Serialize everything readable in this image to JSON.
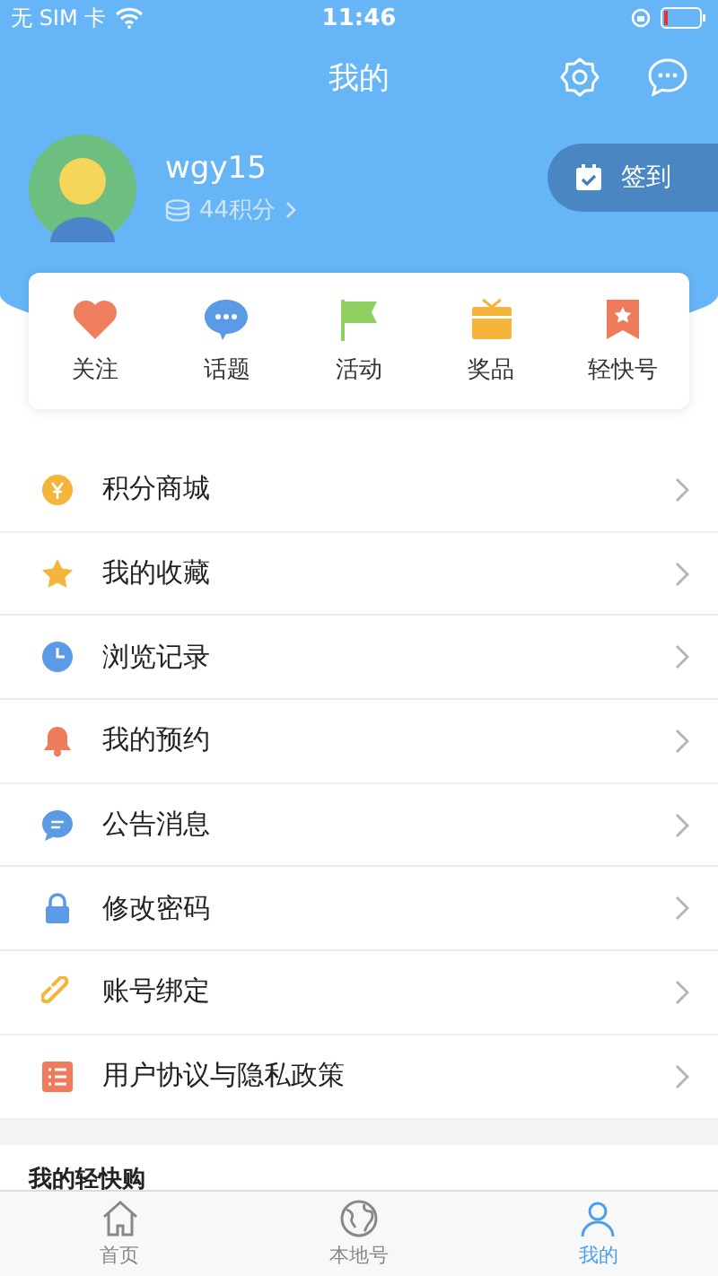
{
  "status_bar": {
    "carrier": "无 SIM 卡",
    "time": "11:46"
  },
  "header": {
    "title": "我的"
  },
  "profile": {
    "username": "wgy15",
    "points": "44积分",
    "checkin": "签到"
  },
  "shortcuts": [
    {
      "label": "关注",
      "kind": "heart",
      "color": "#ef7f5f"
    },
    {
      "label": "话题",
      "kind": "chat",
      "color": "#5b9be6"
    },
    {
      "label": "活动",
      "kind": "flag",
      "color": "#8fd061"
    },
    {
      "label": "奖品",
      "kind": "gift",
      "color": "#f5b43c"
    },
    {
      "label": "轻快号",
      "kind": "bookmark",
      "color": "#ee7c5c"
    }
  ],
  "menu": [
    {
      "label": "积分商城",
      "kind": "coin",
      "color": "#f5b43c"
    },
    {
      "label": "我的收藏",
      "kind": "star",
      "color": "#f5b43c"
    },
    {
      "label": "浏览记录",
      "kind": "clock",
      "color": "#5b9be6"
    },
    {
      "label": "我的预约",
      "kind": "bell",
      "color": "#ee7c5c"
    },
    {
      "label": "公告消息",
      "kind": "message",
      "color": "#5b9be6"
    },
    {
      "label": "修改密码",
      "kind": "lock",
      "color": "#5b9be6"
    },
    {
      "label": "账号绑定",
      "kind": "link",
      "color": "#f5b43c"
    },
    {
      "label": "用户协议与隐私政策",
      "kind": "list",
      "color": "#ee7c5c"
    }
  ],
  "section_title": "我的轻快购",
  "tab_bar": [
    {
      "label": "首页",
      "kind": "home",
      "selected": false
    },
    {
      "label": "本地号",
      "kind": "globe",
      "selected": false
    },
    {
      "label": "我的",
      "kind": "person",
      "selected": true
    }
  ]
}
